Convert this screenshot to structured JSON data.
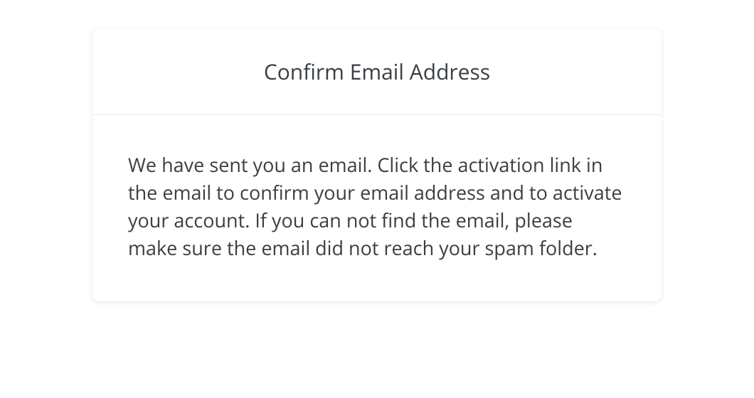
{
  "card": {
    "title": "Confirm Email Address",
    "body": "We have sent you an email. Click the activation link in the email to confirm your email address and to activate your account. If you can not find the email, please make sure the email did not reach your spam folder."
  }
}
